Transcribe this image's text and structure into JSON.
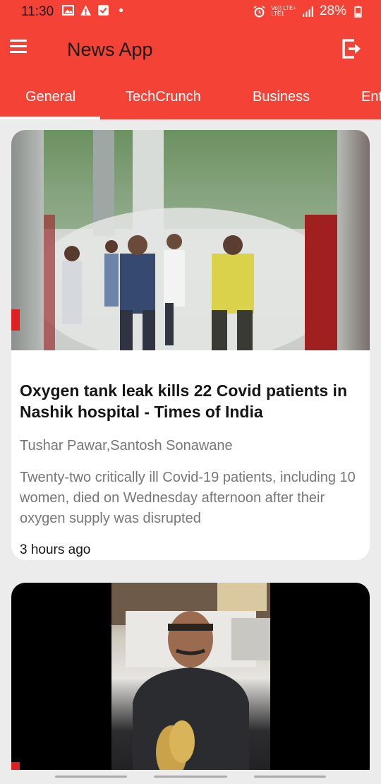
{
  "status_bar": {
    "time": "11:30",
    "battery": "28%",
    "network_top": "Vo)) LTE+",
    "network_bottom": "LTE1"
  },
  "app_bar": {
    "title": "News App",
    "menu_icon": "hamburger-menu-icon",
    "logout_icon": "logout-icon"
  },
  "tabs": [
    {
      "label": "General",
      "selected": true
    },
    {
      "label": "TechCrunch",
      "selected": false
    },
    {
      "label": "Business",
      "selected": false
    },
    {
      "label": "Ent",
      "selected": false
    }
  ],
  "articles": [
    {
      "title": " Oxygen tank leak kills 22 Covid patients in Nashik hospital - Times of India",
      "author": "Tushar Pawar,Santosh Sonawane",
      "description": "Twenty-two critically ill Covid-19 patients, including 10 women, died on Wednesday afternoon after their oxygen supply was disrupted",
      "time": "3 hours ago"
    },
    {
      "title": "",
      "author": "",
      "description": "",
      "time": ""
    }
  ],
  "colors": {
    "primary": "#f44336",
    "background": "#ececec",
    "card": "#ffffff"
  }
}
